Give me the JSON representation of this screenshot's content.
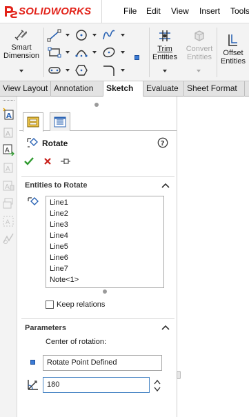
{
  "app": {
    "brand_logo_text": "SOLIDWORKS",
    "menu": [
      "File",
      "Edit",
      "View",
      "Insert",
      "Tools"
    ]
  },
  "ribbon": {
    "smart_dimension": {
      "line1": "Smart",
      "line2": "Dimension"
    },
    "trim_entities": {
      "line1": "Trim",
      "line2": "Entities"
    },
    "convert_entities": {
      "line1": "Convert",
      "line2": "Entities"
    },
    "offset_entities": {
      "line1": "Offset",
      "line2": "Entities"
    }
  },
  "tabs": [
    {
      "label": "View Layout",
      "active": false
    },
    {
      "label": "Annotation",
      "active": false
    },
    {
      "label": "Sketch",
      "active": true
    },
    {
      "label": "Evaluate",
      "active": false
    },
    {
      "label": "Sheet Format",
      "active": false
    }
  ],
  "property_manager": {
    "title": "Rotate",
    "entities_group": {
      "header": "Entities to Rotate",
      "items": [
        "Line1",
        "Line2",
        "Line3",
        "Line4",
        "Line5",
        "Line6",
        "Line7",
        "Note<1>"
      ]
    },
    "keep_relations": {
      "label": "Keep relations",
      "checked": false
    },
    "parameters_group": {
      "header": "Parameters",
      "center_label": "Center of rotation:",
      "center_value": "Rotate Point Defined",
      "angle_value": "180"
    }
  },
  "colors": {
    "brand_red": "#e2231a",
    "accept_green": "#2e9a2e",
    "cancel_red": "#c8201a",
    "selection_blue": "#3b7bd6"
  }
}
